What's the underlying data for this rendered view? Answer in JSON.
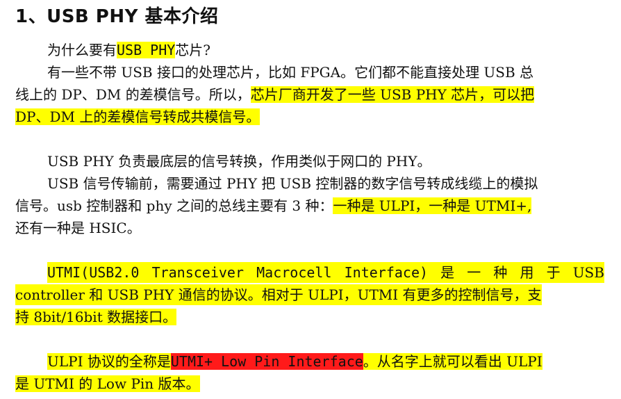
{
  "heading": "1、USB PHY 基本介绍",
  "p1": {
    "a": "为什么要有",
    "b": "USB PHY",
    "c": "芯片?"
  },
  "p2": {
    "l1": "有一些不带 USB 接口的处理芯片，比如 FPGA。它们都不能直接处理 USB 总",
    "l2a": "线上的 DP、DM 的差模信号。所以，",
    "l2b": "芯片厂商开发了一些 USB PHY 芯片，可以把",
    "l3": "DP、DM 上的差模信号转成共模信号。"
  },
  "p3": {
    "l1": "USB PHY 负责最底层的信号转换，作用类似于网口的 PHY。"
  },
  "p4": {
    "l1": "USB 信号传输前，需要通过 PHY 把 USB 控制器的数字信号转成线缆上的模拟",
    "l2a": "信号。usb 控制器和 phy 之间的总线主要有 3 种：",
    "l2b": "一种是 ULPI，一种是 UTMI+,",
    "l3": "还有一种是 HSIC。"
  },
  "p5": {
    "w1": "UTMI(USB2.0",
    "w2": "Transceiver",
    "w3": "Macrocell",
    "w4": "Interface)",
    "w5": "是",
    "w6": "一",
    "w7": "种",
    "w8": "用",
    "w9": "于",
    "w10": "USB",
    "l2": "controller 和 USB PHY 通信的协议。相对于 ULPI，UTMI 有更多的控制信号，支",
    "l3": "持 8bit/16bit 数据接口。"
  },
  "p6": {
    "a": "ULPI 协议的全称是",
    "b": "UTMI+ Low Pin Interface",
    "c": "。从名字上就可以看出 ULPI",
    "l2": "是 UTMI 的 Low Pin 版本。"
  }
}
